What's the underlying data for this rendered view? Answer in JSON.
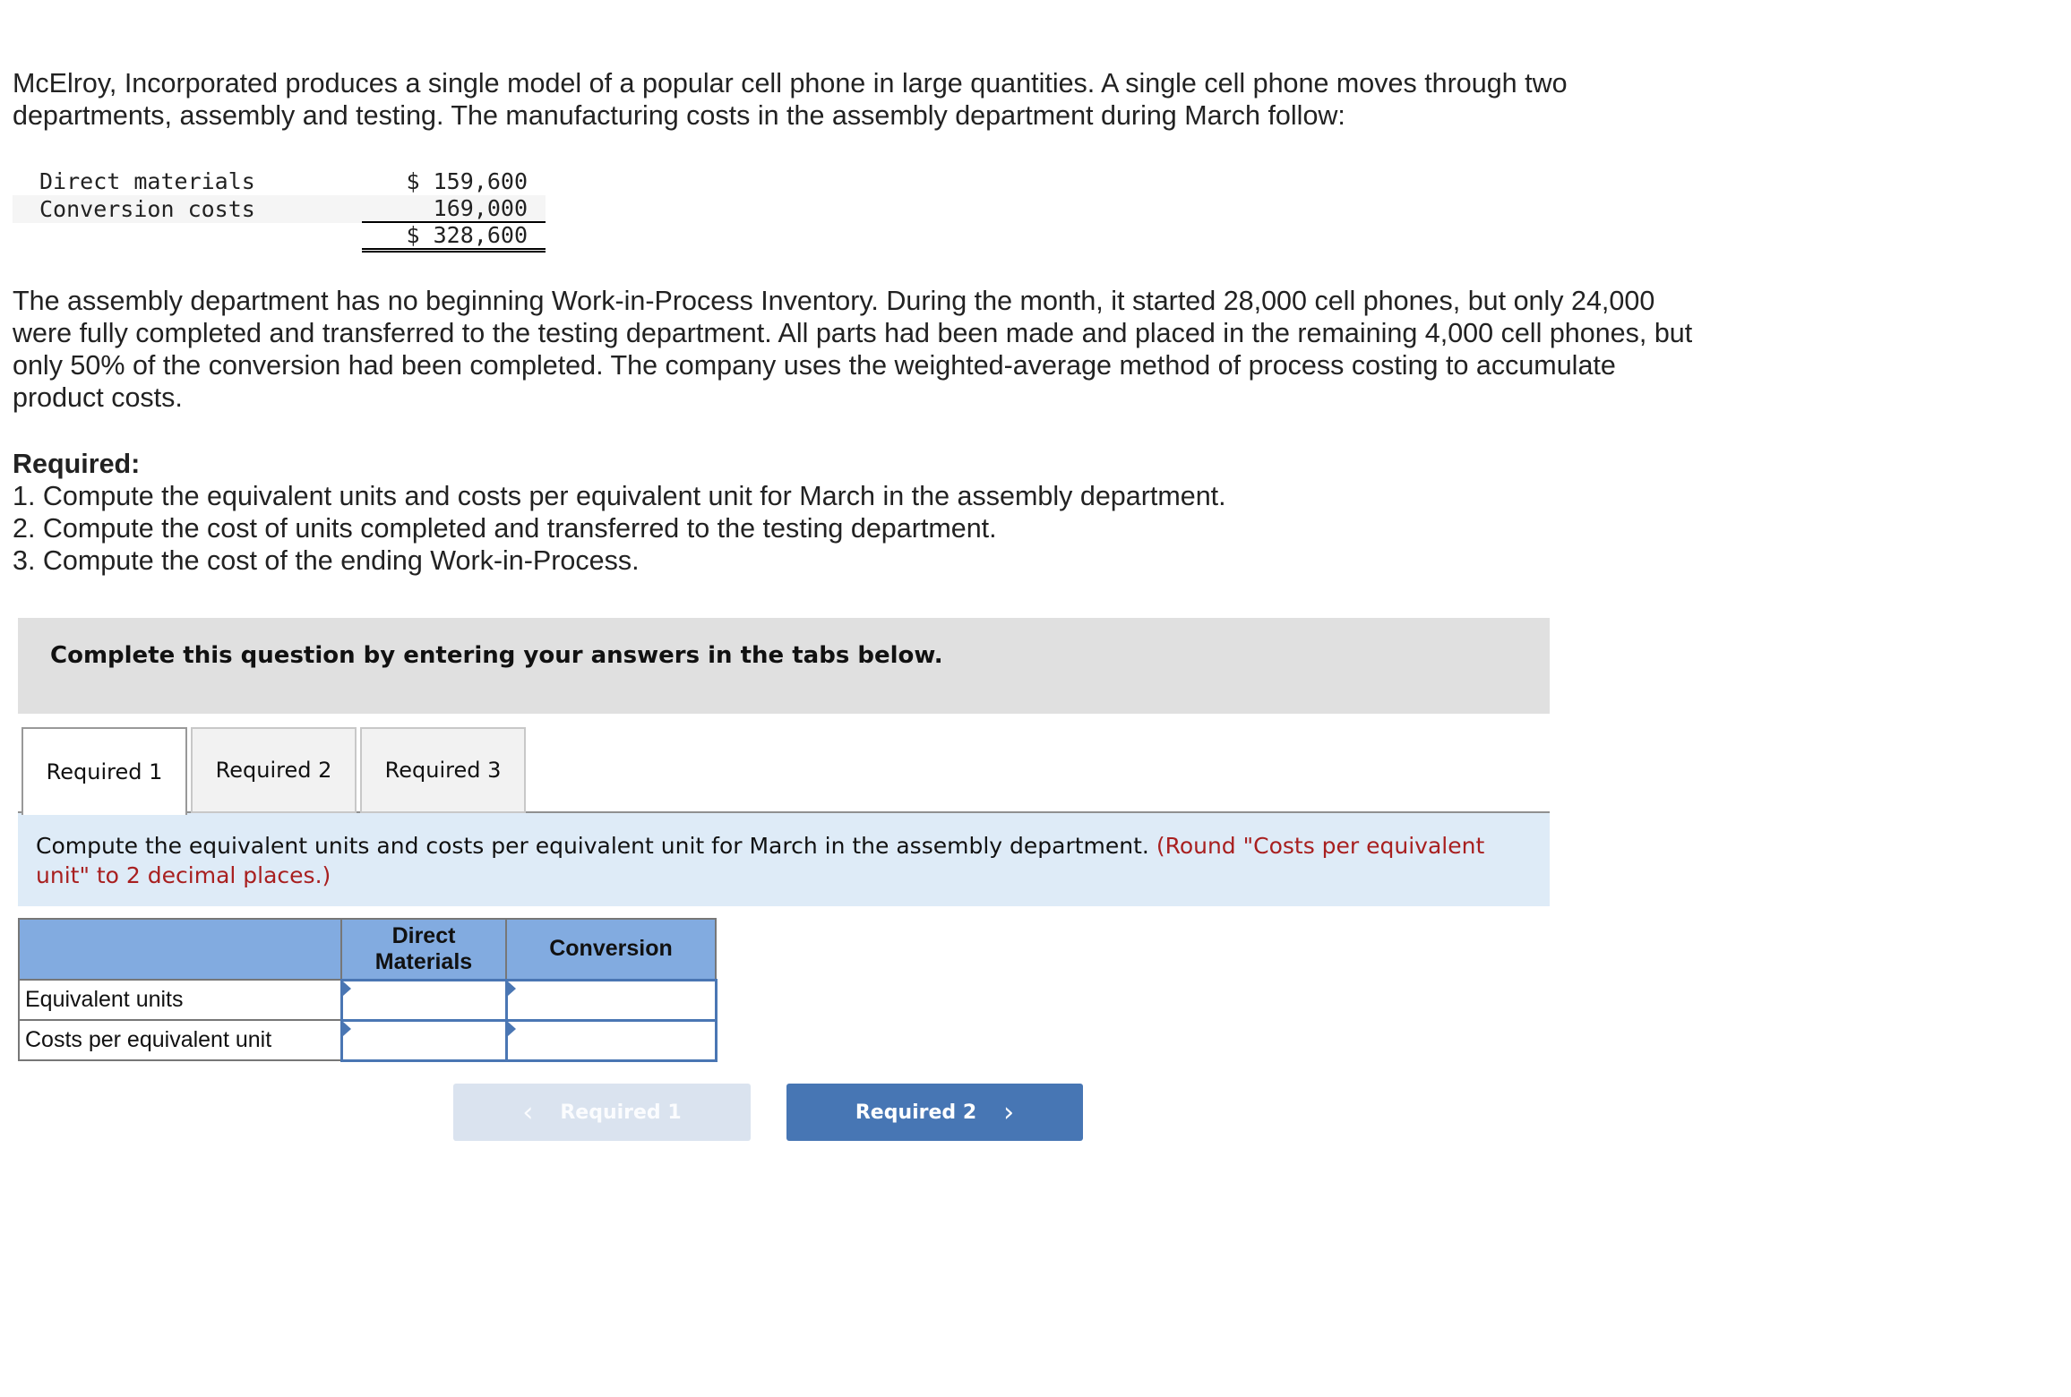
{
  "problem": {
    "intro": "McElroy, Incorporated produces a single model of a popular cell phone in large quantities. A single cell phone moves through two departments, assembly and testing. The manufacturing costs in the assembly department during March follow:",
    "costs": [
      {
        "label": "Direct materials",
        "value": "$ 159,600"
      },
      {
        "label": "Conversion costs",
        "value": "169,000"
      }
    ],
    "costs_total": "$ 328,600",
    "details": "The assembly department has no beginning Work-in-Process Inventory. During the month, it started 28,000 cell phones, but only 24,000 were fully completed and transferred to the testing department. All parts had been made and placed in the remaining 4,000 cell phones, but only 50% of the conversion had been completed. The company uses the weighted-average method of process costing to accumulate product costs.",
    "required_title": "Required:",
    "required_items": [
      "1. Compute the equivalent units and costs per equivalent unit for March in the assembly department.",
      "2. Compute the cost of units completed and transferred to the testing department.",
      "3. Compute the cost of the ending Work-in-Process."
    ]
  },
  "banner": "Complete this question by entering your answers in the tabs below.",
  "tabs": [
    {
      "label": "Required 1",
      "active": true
    },
    {
      "label": "Required 2",
      "active": false
    },
    {
      "label": "Required 3",
      "active": false
    }
  ],
  "instruction": {
    "text": "Compute the equivalent units and costs per equivalent unit for March in the assembly department.",
    "note": "(Round \"Costs per equivalent unit\" to 2 decimal places.)"
  },
  "answer_table": {
    "headers": [
      "",
      "Direct Materials",
      "Conversion"
    ],
    "rows": [
      {
        "label": "Equivalent units",
        "direct_materials": "",
        "conversion": ""
      },
      {
        "label": "Costs per equivalent unit",
        "direct_materials": "",
        "conversion": ""
      }
    ]
  },
  "nav": {
    "prev_label": "Required 1",
    "next_label": "Required 2",
    "prev_icon": "chevron-left-icon",
    "next_icon": "chevron-right-icon"
  },
  "colors": {
    "header_blue": "#82abe0",
    "input_border": "#4a76b3",
    "instruction_bg": "#deebf7",
    "note_red": "#a81f1f",
    "next_button": "#4776b4",
    "prev_button_disabled": "#dae3ef"
  }
}
